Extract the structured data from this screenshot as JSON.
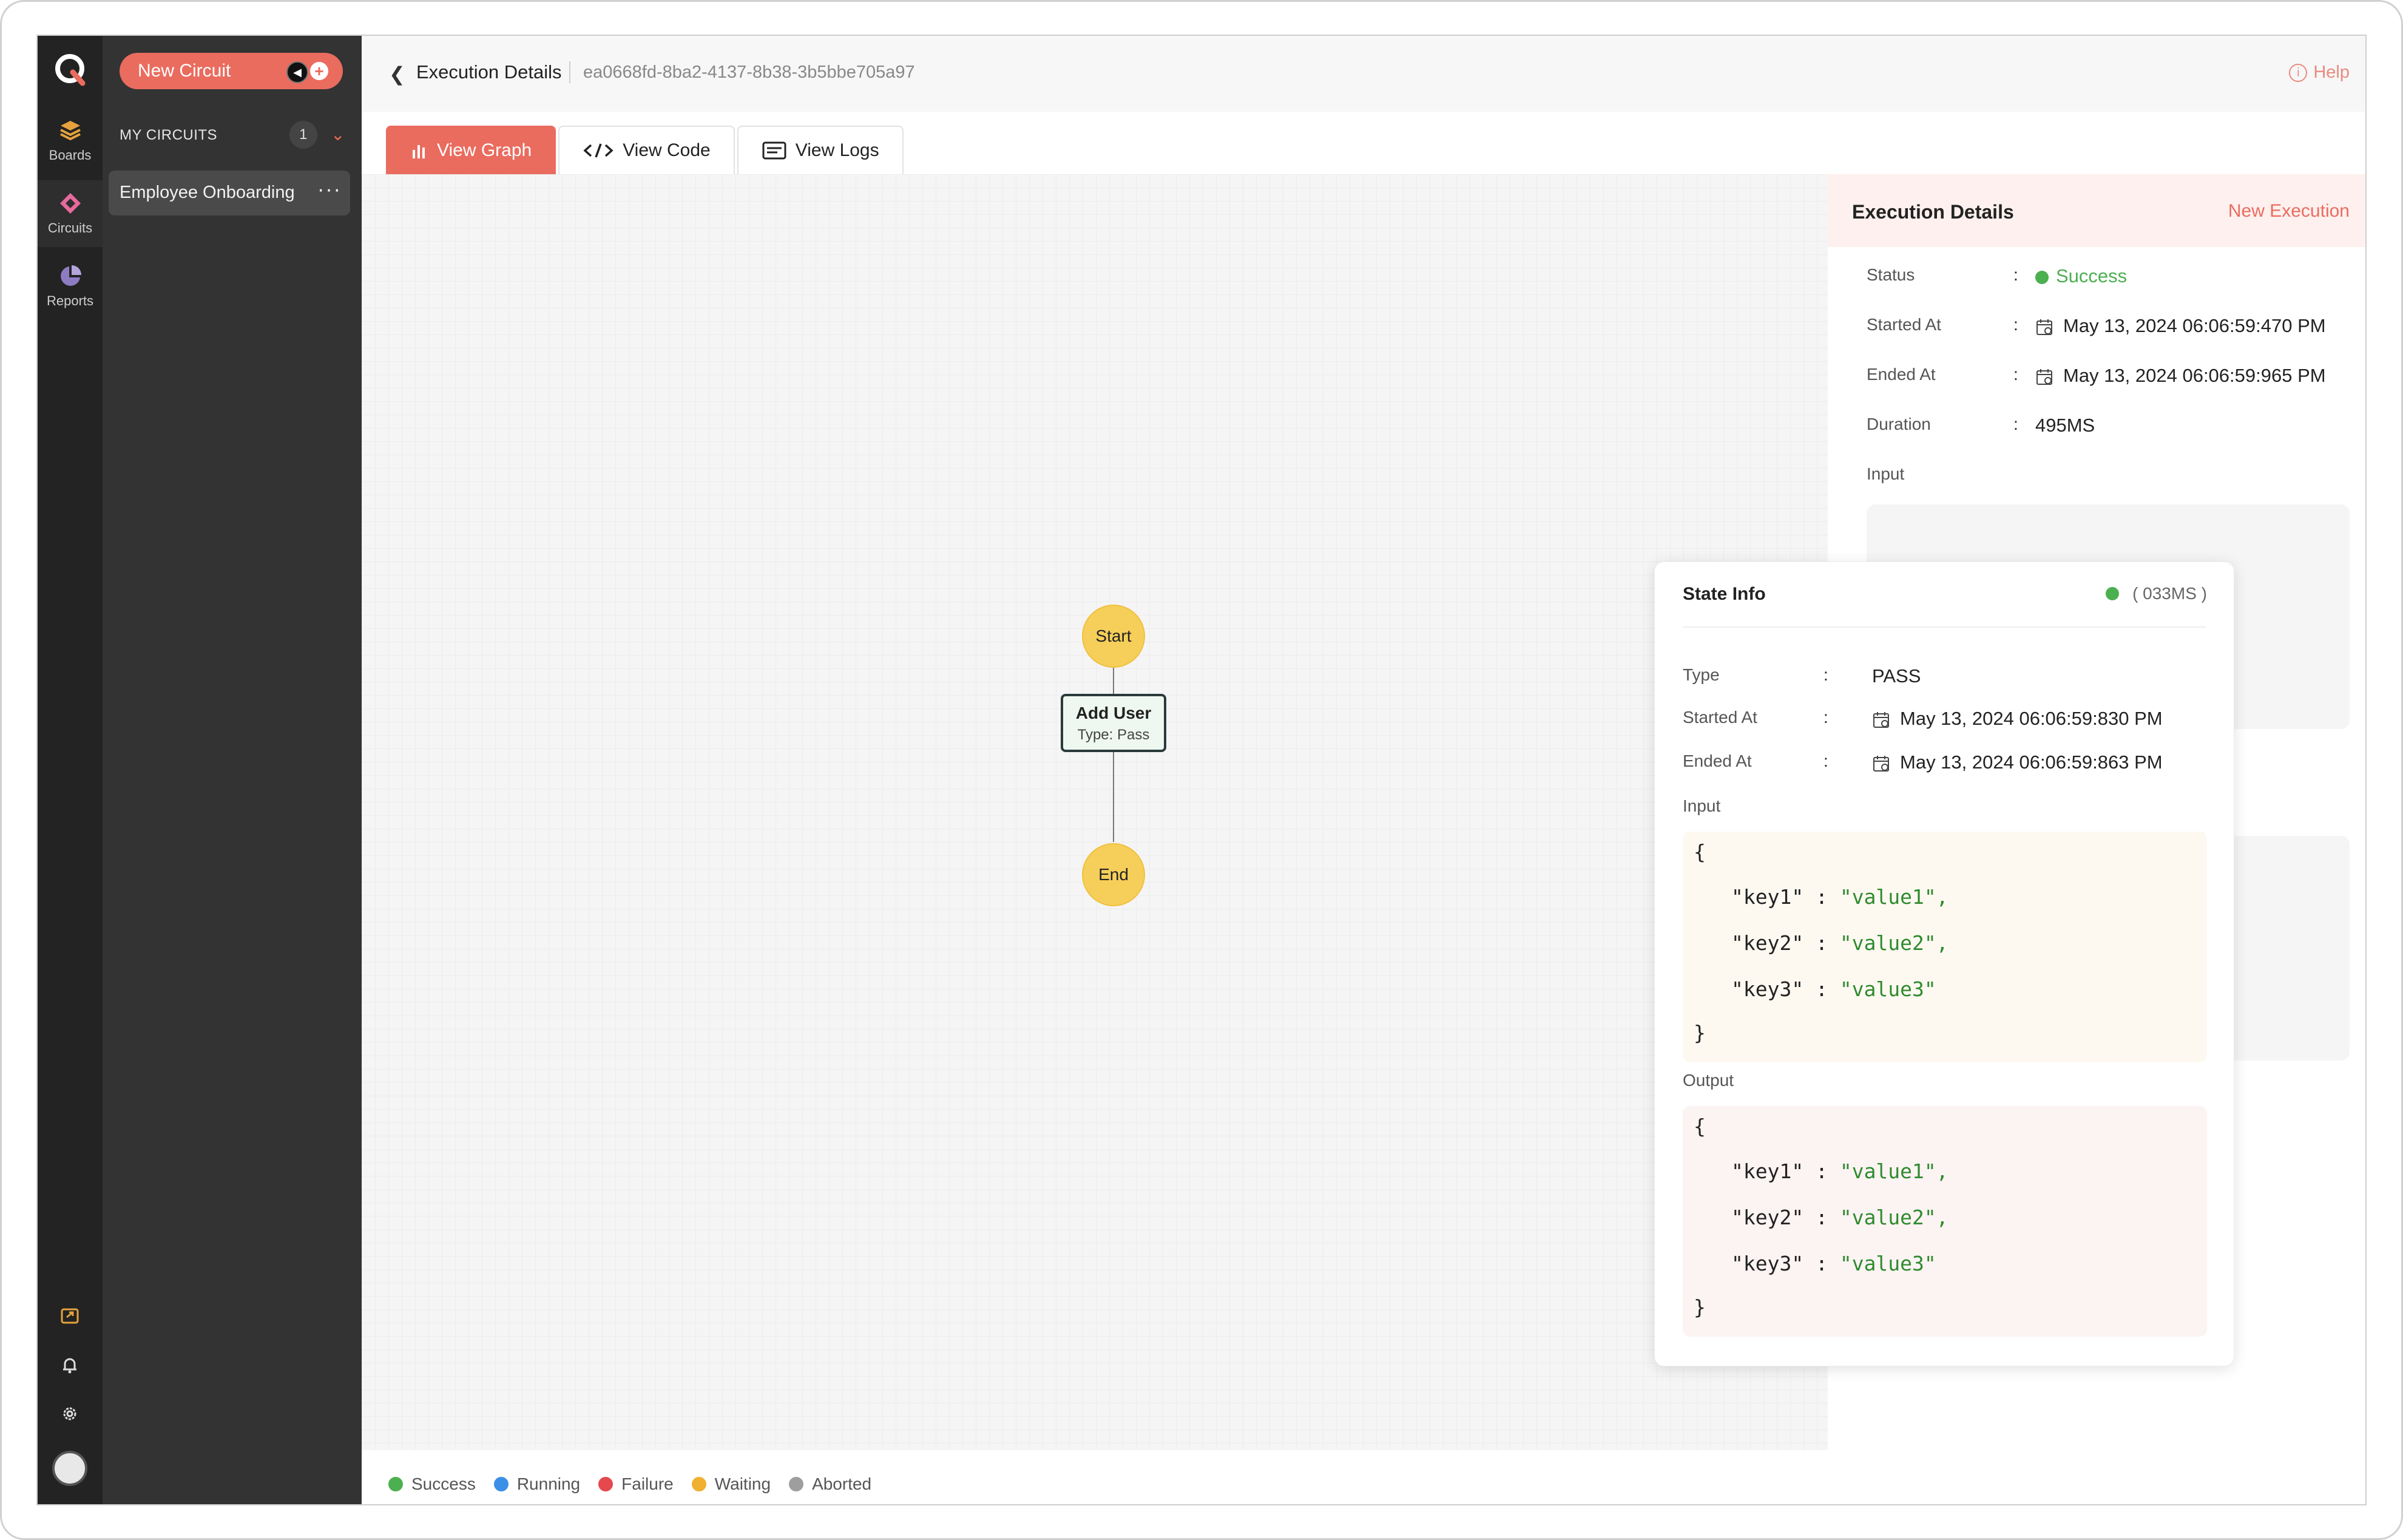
{
  "app": {
    "brand_icon": "q-logo-icon",
    "nav": [
      {
        "label": "Boards",
        "icon": "layers-icon",
        "color": "#e6a23c"
      },
      {
        "label": "Circuits",
        "icon": "diamond-icon",
        "color": "#e86a9c"
      },
      {
        "label": "Reports",
        "icon": "pie-chart-icon",
        "color": "#8e7cc3"
      }
    ],
    "bottom_icons": [
      "feedback-icon",
      "bell-icon",
      "gear-icon",
      "avatar"
    ]
  },
  "sidebar": {
    "new_circuit_label": "New Circuit",
    "section_label": "MY CIRCUITS",
    "count": "1",
    "items": [
      {
        "label": "Employee Onboarding"
      }
    ]
  },
  "header": {
    "title": "Execution Details",
    "execution_id": "ea0668fd-8ba2-4137-8b38-3b5bbe705a97",
    "help_label": "Help"
  },
  "tabs": [
    {
      "label": "View Graph",
      "icon": "bar-chart-icon",
      "active": true
    },
    {
      "label": "View Code",
      "icon": "code-icon",
      "active": false
    },
    {
      "label": "View Logs",
      "icon": "logs-icon",
      "active": false
    }
  ],
  "graph": {
    "nodes": [
      {
        "label": "Start"
      },
      {
        "label": "Add User",
        "subtitle": "Type: Pass"
      },
      {
        "label": "End"
      }
    ]
  },
  "execution": {
    "title": "Execution Details",
    "new_execution_label": "New Execution",
    "rows": [
      {
        "label": "Status",
        "value": "Success"
      },
      {
        "label": "Started At",
        "value": "May 13, 2024 06:06:59:470 PM"
      },
      {
        "label": "Ended At",
        "value": "May 13, 2024 06:06:59:965 PM"
      },
      {
        "label": "Duration",
        "value": "495MS"
      }
    ],
    "input_label": "Input"
  },
  "state_info": {
    "title": "State Info",
    "duration": "( 033MS )",
    "rows": [
      {
        "label": "Type",
        "value": "PASS"
      },
      {
        "label": "Started At",
        "value": "May 13, 2024 06:06:59:830 PM"
      },
      {
        "label": "Ended At",
        "value": "May 13, 2024 06:06:59:863 PM"
      }
    ],
    "input_label": "Input",
    "output_label": "Output",
    "input_json": [
      {
        "key": "\"key1\"",
        "value": "\"value1\","
      },
      {
        "key": "\"key2\"",
        "value": "\"value2\","
      },
      {
        "key": "\"key3\"",
        "value": "\"value3\""
      }
    ],
    "output_json": [
      {
        "key": "\"key1\"",
        "value": "\"value1\","
      },
      {
        "key": "\"key2\"",
        "value": "\"value2\","
      },
      {
        "key": "\"key3\"",
        "value": "\"value3\""
      }
    ]
  },
  "legend": [
    {
      "label": "Success",
      "color": "#4caf50"
    },
    {
      "label": "Running",
      "color": "#3b8fe6"
    },
    {
      "label": "Failure",
      "color": "#e5484d"
    },
    {
      "label": "Waiting",
      "color": "#f0b030"
    },
    {
      "label": "Aborted",
      "color": "#9e9e9e"
    }
  ],
  "colors": {
    "accent": "#ea6c5f",
    "success": "#4caf50",
    "node_fill": "#f6cf5a"
  }
}
